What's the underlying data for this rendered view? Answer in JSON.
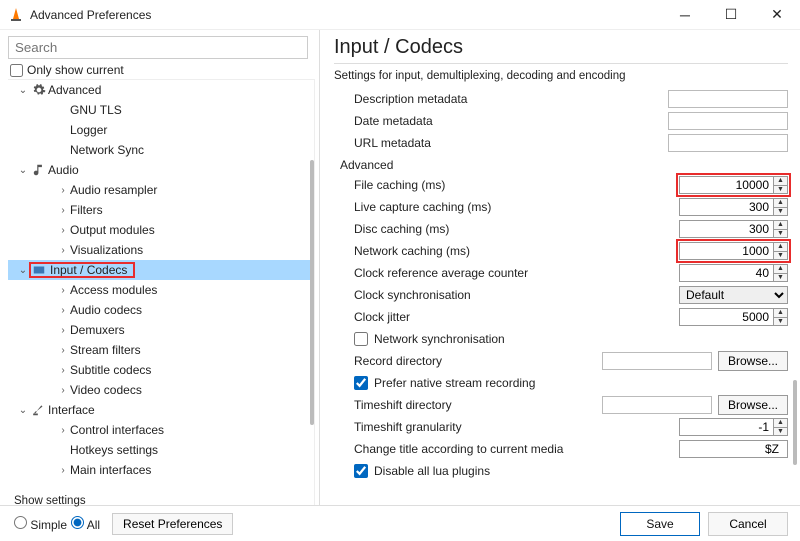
{
  "window": {
    "title": "Advanced Preferences"
  },
  "left": {
    "search_placeholder": "Search",
    "only_current": "Only show current",
    "tree": {
      "advanced": "Advanced",
      "gnutls": "GNU TLS",
      "logger": "Logger",
      "netsync": "Network Sync",
      "audio": "Audio",
      "aresampler": "Audio resampler",
      "afilters": "Filters",
      "aoutput": "Output modules",
      "avisual": "Visualizations",
      "inputcodecs": "Input / Codecs",
      "accessmod": "Access modules",
      "acodec": "Audio codecs",
      "demux": "Demuxers",
      "streamf": "Stream filters",
      "subcodec": "Subtitle codecs",
      "vcodec": "Video codecs",
      "interface": "Interface",
      "ctrlif": "Control interfaces",
      "hotkeys": "Hotkeys settings",
      "mainif": "Main interfaces"
    }
  },
  "right": {
    "title": "Input / Codecs",
    "subtitle": "Settings for input, demultiplexing, decoding and encoding",
    "meta": {
      "desc": "Description metadata",
      "date": "Date metadata",
      "url": "URL metadata"
    },
    "adv": {
      "header": "Advanced",
      "file_caching_label": "File caching (ms)",
      "file_caching_value": "10000",
      "live_caching_label": "Live capture caching (ms)",
      "live_caching_value": "300",
      "disc_caching_label": "Disc caching (ms)",
      "disc_caching_value": "300",
      "net_caching_label": "Network caching (ms)",
      "net_caching_value": "1000",
      "clock_ref_label": "Clock reference average counter",
      "clock_ref_value": "40",
      "clock_sync_label": "Clock synchronisation",
      "clock_sync_value": "Default",
      "clock_jitter_label": "Clock jitter",
      "clock_jitter_value": "5000",
      "net_sync_chk": "Network synchronisation",
      "rec_dir": "Record directory",
      "browse": "Browse...",
      "prefer_native": "Prefer native stream recording",
      "timeshift_dir": "Timeshift directory",
      "timeshift_gran_label": "Timeshift granularity",
      "timeshift_gran_value": "-1",
      "change_title_label": "Change title according to current media",
      "change_title_value": "$Z",
      "disable_lua": "Disable all lua plugins"
    }
  },
  "footer": {
    "show_settings": "Show settings",
    "simple": "Simple",
    "all": "All",
    "reset": "Reset Preferences",
    "save": "Save",
    "cancel": "Cancel"
  }
}
